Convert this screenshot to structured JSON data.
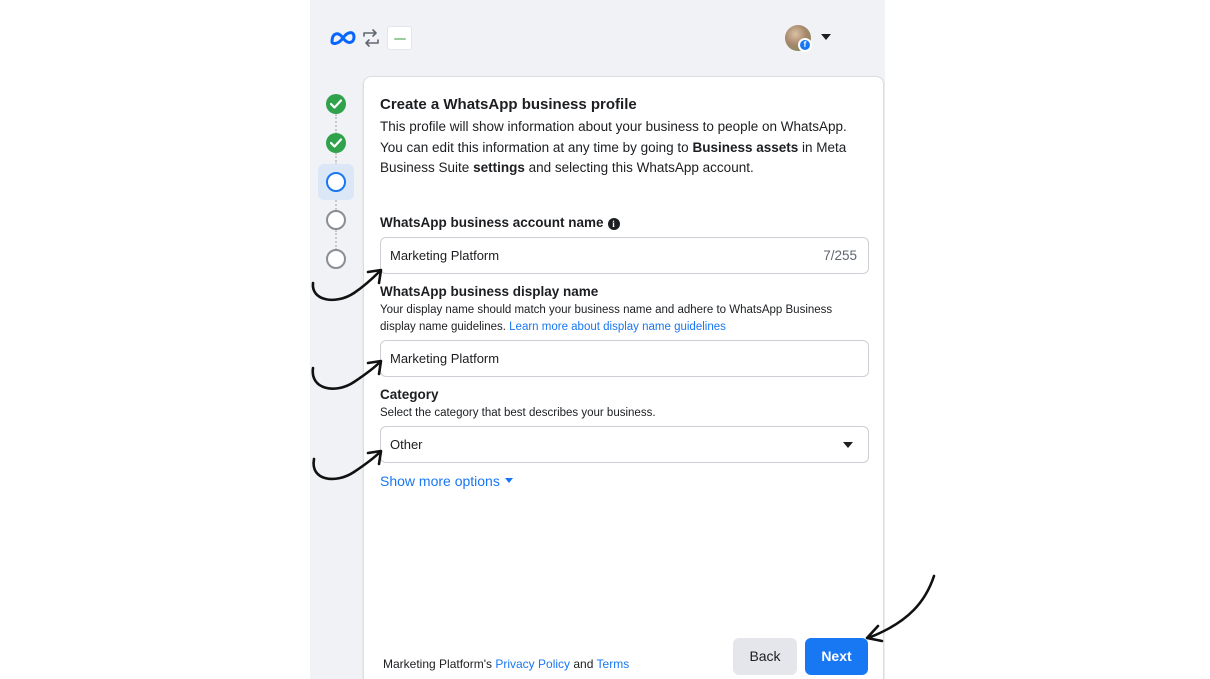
{
  "header": {
    "meta_logo_icon": "meta-infinity-logo",
    "swap_icon": "swap-arrows-icon",
    "business_logo": "business-logo-thumbnail",
    "avatar": "user-avatar-with-facebook-badge",
    "avatar_badge_glyph": "f"
  },
  "stepper": {
    "steps": [
      {
        "state": "complete"
      },
      {
        "state": "complete"
      },
      {
        "state": "current"
      },
      {
        "state": "todo"
      },
      {
        "state": "todo"
      }
    ]
  },
  "form": {
    "title": "Create a WhatsApp business profile",
    "intro": {
      "text1": "This profile will show information about your business to people on WhatsApp. You can edit this information at any time by going to ",
      "bold1": "Business assets",
      "text2": " in Meta Business Suite ",
      "bold2": "settings",
      "text3": " and selecting this WhatsApp account."
    },
    "account_name": {
      "label": "WhatsApp business account name",
      "info_glyph": "i",
      "value": "Marketing Platform",
      "counter": "7/255"
    },
    "display_name": {
      "label": "WhatsApp business display name",
      "help": "Your display name should match your business name and adhere to WhatsApp Business display name guidelines.",
      "help_link": "Learn more about display name guidelines",
      "value": "Marketing Platform"
    },
    "category": {
      "label": "Category",
      "help": "Select the category that best describes your business.",
      "value": "Other"
    },
    "show_more": "Show more options"
  },
  "footer": {
    "prefix": "Marketing Platform's",
    "privacy": "Privacy Policy",
    "and": "and",
    "terms": "Terms",
    "back": "Back",
    "next": "Next"
  },
  "colors": {
    "accent": "#1877f2",
    "success": "#31a24c",
    "panel_bg": "#f0f2f5"
  }
}
